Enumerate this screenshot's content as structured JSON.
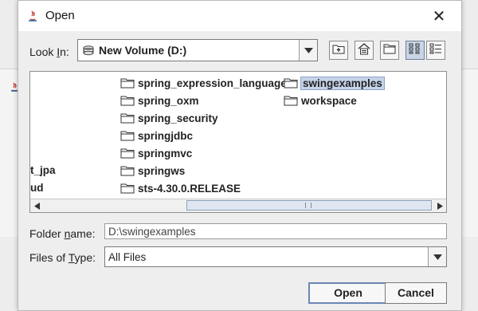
{
  "window": {
    "title": "Open",
    "close_glyph": "✕"
  },
  "background_window": {
    "close_glyph": "✕"
  },
  "look_in": {
    "label_pre": "Look ",
    "label_mnemonic": "I",
    "label_post": "n:",
    "value": "New Volume (D:)"
  },
  "toolbar": {
    "up_one_level": "up-folder-icon",
    "home": "home-icon",
    "new_folder": "new-folder-icon",
    "list_view": "list-view-icon",
    "details_view": "details-view-icon"
  },
  "files": {
    "clipped": [
      "t_jpa",
      "ud"
    ],
    "column1": [
      "spring_expression_language",
      "spring_oxm",
      "spring_security",
      "springjdbc",
      "springmvc",
      "springws",
      "sts-4.30.0.RELEASE"
    ],
    "column2": [
      "swingexamples",
      "workspace"
    ],
    "selected": "swingexamples"
  },
  "folder_name": {
    "label_pre": "Folder ",
    "label_mnemonic": "n",
    "label_post": "ame:",
    "value": "D:\\swingexamples"
  },
  "files_of_type": {
    "label_pre": "Files of ",
    "label_mnemonic": "T",
    "label_post": "ype:",
    "value": "All Files"
  },
  "buttons": {
    "open": "Open",
    "cancel": "Cancel"
  },
  "colors": {
    "selection": "#c5d3e8",
    "accent": "#6b86b4"
  }
}
